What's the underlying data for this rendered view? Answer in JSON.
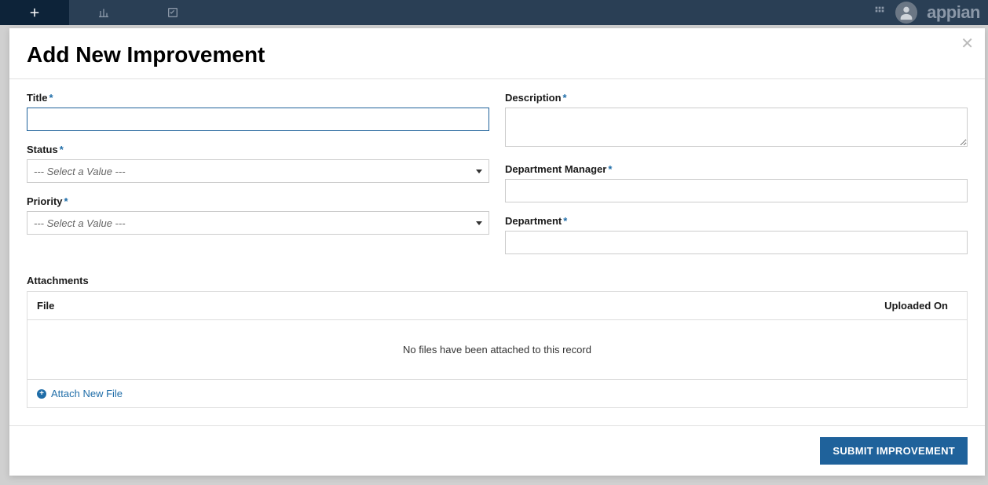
{
  "modal": {
    "title": "Add New Improvement",
    "submitButton": "SUBMIT IMPROVEMENT"
  },
  "form": {
    "titleLabel": "Title",
    "titleValue": "",
    "statusLabel": "Status",
    "statusPlaceholder": "--- Select a Value ---",
    "priorityLabel": "Priority",
    "priorityPlaceholder": "--- Select a Value ---",
    "descriptionLabel": "Description",
    "descriptionValue": "",
    "deptManagerLabel": "Department Manager",
    "deptManagerValue": "",
    "departmentLabel": "Department",
    "departmentValue": ""
  },
  "attachments": {
    "label": "Attachments",
    "fileHeader": "File",
    "uploadedHeader": "Uploaded On",
    "emptyMessage": "No files have been attached to this record",
    "attachLink": "Attach New File"
  },
  "brand": "appian"
}
